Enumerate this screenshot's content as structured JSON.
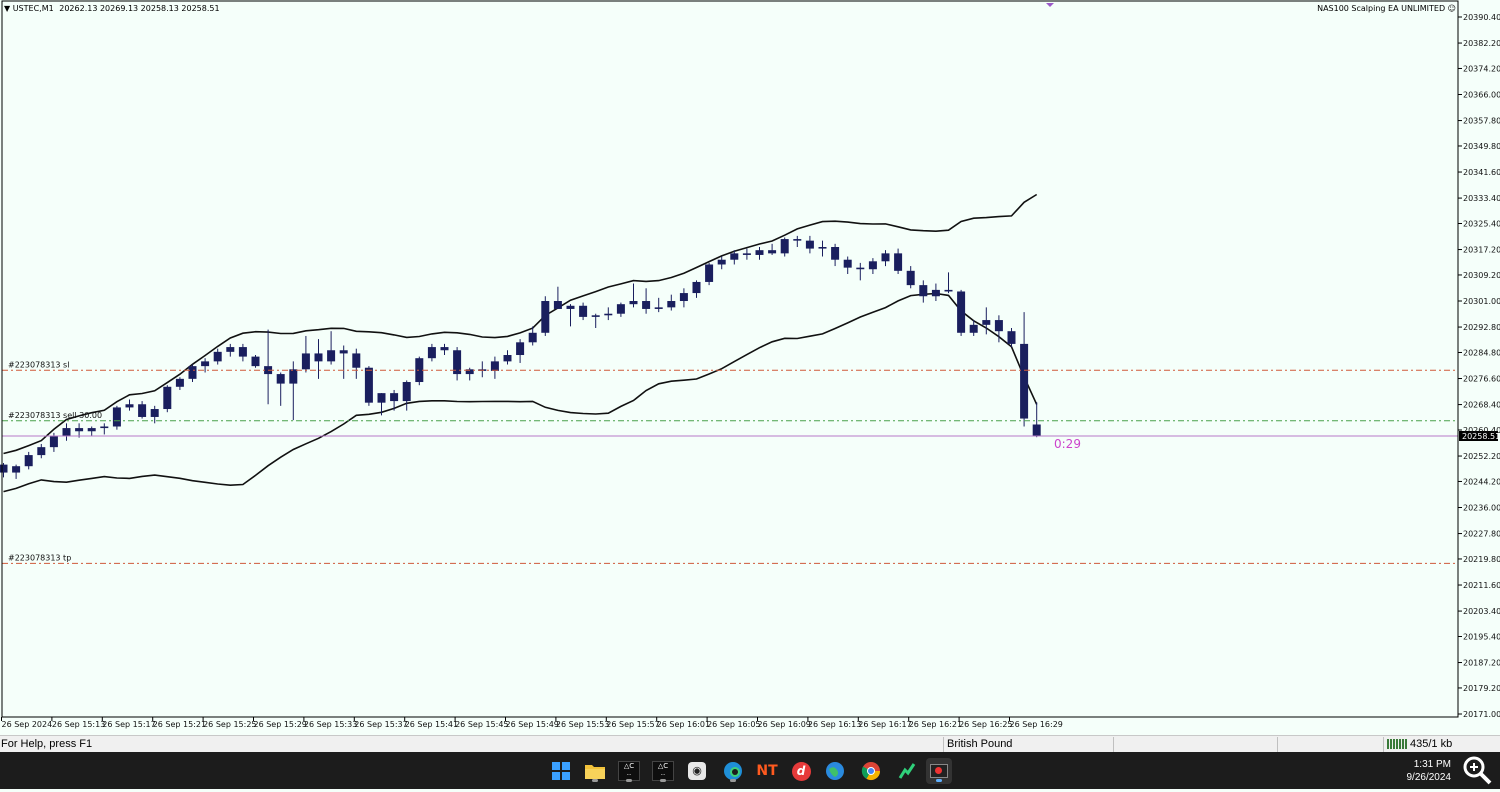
{
  "chart_header": {
    "symbol_label": "USTEC,M1",
    "ohlc_text": "20262.13 20269.13 20258.13 20258.51",
    "ea_label": "NAS100 Scalping EA UNLIMITED",
    "ea_icon": "smiley-icon"
  },
  "countdown": "0:29",
  "order_labels": {
    "sl": "#223078313 sl",
    "entry": "#223078313 sell 30.00",
    "tp": "#223078313 tp"
  },
  "colors": {
    "background": "#f5fffa",
    "candle": "#1a1f5e",
    "band": "#111111",
    "sl_tp_line": "#d05a3a",
    "entry_line": "#4aa04a",
    "bid_line": "#b678c8",
    "countdown": "#cc44cc",
    "price_tag_bg": "#000000"
  },
  "chart_data": {
    "type": "candlestick",
    "symbol": "USTEC",
    "timeframe": "M1",
    "y_ticks": [
      "20390.40",
      "20382.20",
      "20374.20",
      "20366.00",
      "20357.80",
      "20349.80",
      "20341.60",
      "20333.40",
      "20325.40",
      "20317.20",
      "20309.20",
      "20301.00",
      "20292.80",
      "20284.80",
      "20276.60",
      "20268.40",
      "20260.40",
      "20252.20",
      "20244.20",
      "20236.00",
      "20227.80",
      "20219.80",
      "20211.60",
      "20203.40",
      "20195.40",
      "20187.20",
      "20179.20",
      "20171.00"
    ],
    "x_ticks": [
      "26 Sep 2024",
      "26 Sep 15:13",
      "26 Sep 15:17",
      "26 Sep 15:21",
      "26 Sep 15:25",
      "26 Sep 15:29",
      "26 Sep 15:33",
      "26 Sep 15:37",
      "26 Sep 15:41",
      "26 Sep 15:45",
      "26 Sep 15:49",
      "26 Sep 15:53",
      "26 Sep 15:57",
      "26 Sep 16:01",
      "26 Sep 16:05",
      "26 Sep 16:09",
      "26 Sep 16:13",
      "26 Sep 16:17",
      "26 Sep 16:21",
      "26 Sep 16:25",
      "26 Sep 16:29"
    ],
    "ylim": [
      20171.0,
      20390.4
    ],
    "current_price": "20258.51",
    "levels": {
      "sl": 20279.2,
      "entry": 20263.3,
      "tp": 20218.4,
      "bid": 20258.51
    },
    "candles": [
      [
        20249.5,
        20250.0,
        20245.5,
        20247.0
      ],
      [
        20247.0,
        20249.5,
        20245.0,
        20249.0
      ],
      [
        20249.0,
        20253.5,
        20248.0,
        20252.5
      ],
      [
        20252.5,
        20256.0,
        20251.5,
        20255.0
      ],
      [
        20255.0,
        20259.5,
        20253.5,
        20258.5
      ],
      [
        20258.5,
        20262.5,
        20257.0,
        20261.0
      ],
      [
        20261.0,
        20262.5,
        20258.0,
        20260.0
      ],
      [
        20260.0,
        20261.5,
        20258.5,
        20261.0
      ],
      [
        20261.0,
        20262.5,
        20259.0,
        20261.5
      ],
      [
        20261.5,
        20268.0,
        20260.5,
        20267.5
      ],
      [
        20267.5,
        20270.0,
        20266.5,
        20268.5
      ],
      [
        20268.5,
        20269.5,
        20264.0,
        20264.5
      ],
      [
        20264.5,
        20268.0,
        20262.5,
        20267.0
      ],
      [
        20267.0,
        20274.5,
        20266.0,
        20274.0
      ],
      [
        20274.0,
        20277.0,
        20273.0,
        20276.5
      ],
      [
        20276.5,
        20281.0,
        20275.5,
        20280.5
      ],
      [
        20280.5,
        20283.0,
        20278.5,
        20282.0
      ],
      [
        20282.0,
        20286.0,
        20281.0,
        20285.0
      ],
      [
        20285.0,
        20287.5,
        20283.5,
        20286.5
      ],
      [
        20286.5,
        20287.5,
        20282.0,
        20283.5
      ],
      [
        20283.5,
        20284.0,
        20280.0,
        20280.5
      ],
      [
        20280.5,
        20292.0,
        20268.5,
        20278.0
      ],
      [
        20278.0,
        20278.5,
        20268.0,
        20275.0
      ],
      [
        20275.0,
        20282.0,
        20263.5,
        20279.5
      ],
      [
        20279.5,
        20290.0,
        20278.5,
        20284.5
      ],
      [
        20284.5,
        20289.0,
        20276.5,
        20282.0
      ],
      [
        20282.0,
        20291.5,
        20281.0,
        20285.5
      ],
      [
        20285.5,
        20287.0,
        20276.5,
        20284.5
      ],
      [
        20284.5,
        20286.0,
        20276.5,
        20280.0
      ],
      [
        20280.0,
        20280.5,
        20268.0,
        20269.0
      ],
      [
        20269.0,
        20272.0,
        20265.0,
        20272.0
      ],
      [
        20272.0,
        20273.0,
        20266.5,
        20269.5
      ],
      [
        20269.5,
        20276.0,
        20266.5,
        20275.5
      ],
      [
        20275.5,
        20283.5,
        20274.5,
        20283.0
      ],
      [
        20283.0,
        20287.5,
        20282.0,
        20286.5
      ],
      [
        20286.5,
        20287.5,
        20284.0,
        20285.5
      ],
      [
        20285.5,
        20286.5,
        20276.0,
        20278.0
      ],
      [
        20278.0,
        20280.0,
        20276.0,
        20279.5
      ],
      [
        20279.5,
        20282.0,
        20277.0,
        20279.0
      ],
      [
        20279.0,
        20283.5,
        20276.5,
        20282.0
      ],
      [
        20282.0,
        20285.5,
        20281.0,
        20284.0
      ],
      [
        20284.0,
        20289.0,
        20281.5,
        20288.0
      ],
      [
        20288.0,
        20293.0,
        20287.0,
        20291.0
      ],
      [
        20291.0,
        20302.5,
        20290.0,
        20301.0
      ],
      [
        20301.0,
        20305.5,
        20299.0,
        20298.5
      ],
      [
        20298.5,
        20300.0,
        20293.0,
        20299.5
      ],
      [
        20299.5,
        20300.5,
        20295.0,
        20296.0
      ],
      [
        20296.0,
        20297.0,
        20292.5,
        20296.5
      ],
      [
        20296.5,
        20299.0,
        20295.0,
        20297.0
      ],
      [
        20297.0,
        20300.5,
        20296.0,
        20300.0
      ],
      [
        20300.0,
        20306.5,
        20299.0,
        20301.0
      ],
      [
        20301.0,
        20305.0,
        20297.0,
        20298.5
      ],
      [
        20298.5,
        20302.0,
        20297.5,
        20299.0
      ],
      [
        20299.0,
        20303.0,
        20298.0,
        20301.0
      ],
      [
        20301.0,
        20305.0,
        20299.0,
        20303.5
      ],
      [
        20303.5,
        20307.5,
        20302.0,
        20307.0
      ],
      [
        20307.0,
        20313.0,
        20306.0,
        20312.5
      ],
      [
        20312.5,
        20315.0,
        20311.0,
        20314.0
      ],
      [
        20314.0,
        20317.0,
        20312.5,
        20316.0
      ],
      [
        20316.0,
        20317.5,
        20314.0,
        20315.5
      ],
      [
        20315.5,
        20318.0,
        20314.0,
        20317.0
      ],
      [
        20317.0,
        20319.0,
        20315.5,
        20316.0
      ],
      [
        20316.0,
        20321.0,
        20315.0,
        20320.5
      ],
      [
        20320.5,
        20321.5,
        20318.0,
        20320.0
      ],
      [
        20320.0,
        20321.5,
        20316.0,
        20317.5
      ],
      [
        20317.5,
        20320.0,
        20315.0,
        20318.0
      ],
      [
        20318.0,
        20319.0,
        20312.0,
        20314.0
      ],
      [
        20314.0,
        20315.0,
        20309.5,
        20311.5
      ],
      [
        20311.5,
        20313.0,
        20307.5,
        20311.0
      ],
      [
        20311.0,
        20314.5,
        20309.5,
        20313.5
      ],
      [
        20313.5,
        20317.0,
        20312.0,
        20316.0
      ],
      [
        20316.0,
        20317.5,
        20309.5,
        20310.5
      ],
      [
        20310.5,
        20312.0,
        20305.0,
        20306.0
      ],
      [
        20306.0,
        20307.5,
        20300.5,
        20302.5
      ],
      [
        20302.5,
        20306.5,
        20301.0,
        20304.5
      ],
      [
        20304.5,
        20310.0,
        20303.5,
        20304.0
      ],
      [
        20304.0,
        20304.5,
        20290.0,
        20291.0
      ],
      [
        20291.0,
        20295.0,
        20290.0,
        20293.5
      ],
      [
        20293.5,
        20299.0,
        20290.5,
        20295.0
      ],
      [
        20295.0,
        20296.5,
        20288.0,
        20291.5
      ],
      [
        20291.5,
        20292.5,
        20286.5,
        20287.5
      ],
      [
        20287.5,
        20297.5,
        20261.5,
        20264.0
      ],
      [
        20262.13,
        20269.13,
        20258.13,
        20258.51
      ]
    ]
  },
  "status_bar": {
    "help_text": "For Help, press F1",
    "profile_text": "British Pound",
    "traffic_text": "435/1 kb",
    "traffic_icon": "connection-bars-icon"
  },
  "taskbar": {
    "icons": [
      "windows-start-icon",
      "file-explorer-icon",
      "amc-markets-terminal-icon",
      "amc-markets-terminal-2-icon",
      "app-fox-icon",
      "edge-browser-icon",
      "ninjatrader-icon",
      "red-d-app-icon",
      "globe-browser-icon",
      "chrome-browser-icon",
      "green-chart-app-icon",
      "screen-recorder-icon"
    ],
    "time": "1:31 PM",
    "date": "9/26/2024",
    "zoom_icon": "magnifier-icon"
  }
}
